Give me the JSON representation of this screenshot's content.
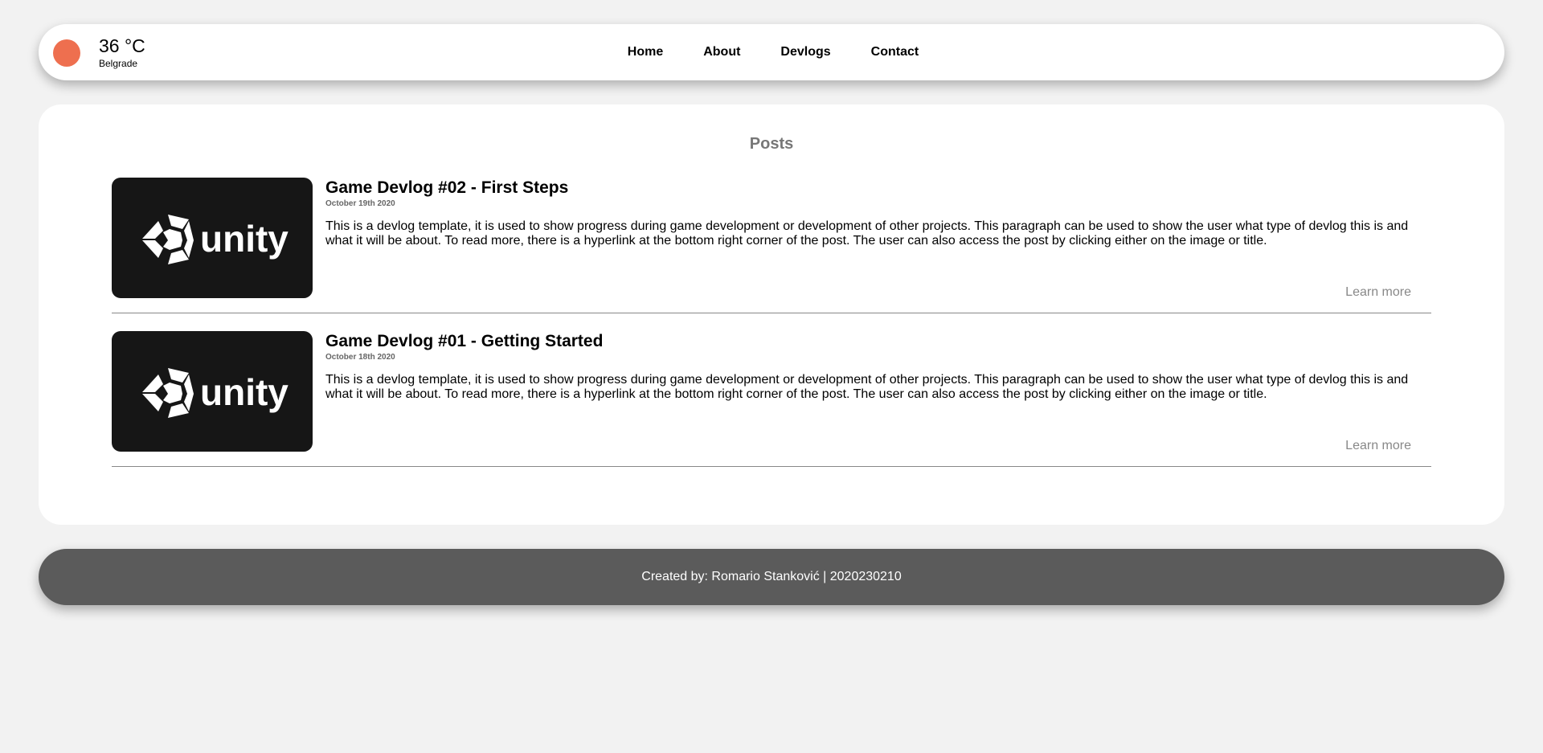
{
  "weather": {
    "temperature": "36 °C",
    "city": "Belgrade",
    "indicator_color": "#ee6f4f"
  },
  "nav": {
    "items": [
      {
        "label": "Home"
      },
      {
        "label": "About"
      },
      {
        "label": "Devlogs"
      },
      {
        "label": "Contact"
      }
    ]
  },
  "main": {
    "title": "Posts",
    "posts": [
      {
        "thumbnail_icon": "unity-logo-icon",
        "thumbnail_text": "unity",
        "title": "Game Devlog #02 - First Steps",
        "date": "October 19th 2020",
        "body": "This is a devlog template, it is used to show progress during game development or development of other projects. This paragraph can be used to show the user what type of devlog this is and what it will be about. To read more, there is a hyperlink at the bottom right corner of the post. The user can also access the post by clicking either on the image or title.",
        "link_label": "Learn more"
      },
      {
        "thumbnail_icon": "unity-logo-icon",
        "thumbnail_text": "unity",
        "title": "Game Devlog #01 - Getting Started",
        "date": "October 18th 2020",
        "body": "This is a devlog template, it is used to show progress during game development or development of other projects. This paragraph can be used to show the user what type of devlog this is and what it will be about. To read more, there is a hyperlink at the bottom right corner of the post. The user can also access the post by clicking either on the image or title.",
        "link_label": "Learn more"
      }
    ]
  },
  "footer": {
    "text": "Created by: Romario Stanković | 2020230210",
    "background_color": "#5b5b5b"
  }
}
